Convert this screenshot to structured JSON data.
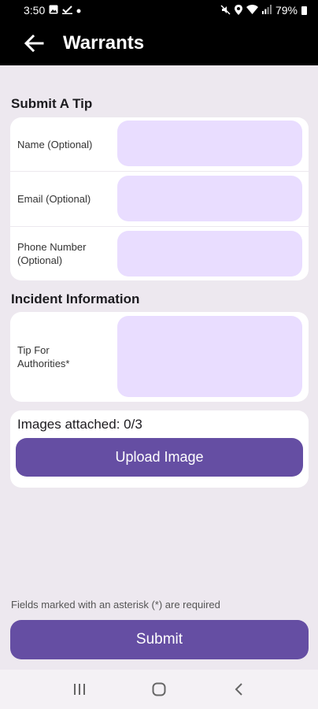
{
  "status_bar": {
    "time": "3:50",
    "battery": "79%",
    "left_icons": [
      "gallery-icon",
      "check-icon",
      "notification-dot-icon"
    ],
    "right_icons": [
      "mute-icon",
      "location-icon",
      "wifi-icon",
      "signal-icon",
      "battery-icon"
    ]
  },
  "app_bar": {
    "title": "Warrants",
    "back_icon": "arrow-left-icon"
  },
  "submit_tip": {
    "title": "Submit A Tip",
    "fields": [
      {
        "label": "Name (Optional)",
        "value": ""
      },
      {
        "label": "Email (Optional)",
        "value": ""
      },
      {
        "label": "Phone Number (Optional)",
        "value": ""
      }
    ]
  },
  "incident": {
    "title": "Incident Information",
    "tip_label": "Tip For Authorities*",
    "tip_value": ""
  },
  "images": {
    "count_text": "Images attached: 0/3",
    "upload_label": "Upload Image"
  },
  "footer": {
    "note": "Fields marked with an asterisk (*) are required",
    "submit_label": "Submit"
  },
  "nav": {
    "icons": [
      "recent-apps-icon",
      "home-icon",
      "back-icon"
    ]
  },
  "colors": {
    "accent": "#654ea3",
    "input_fill": "#e9ddff",
    "background": "#ede8ef",
    "app_bar": "#000000"
  }
}
